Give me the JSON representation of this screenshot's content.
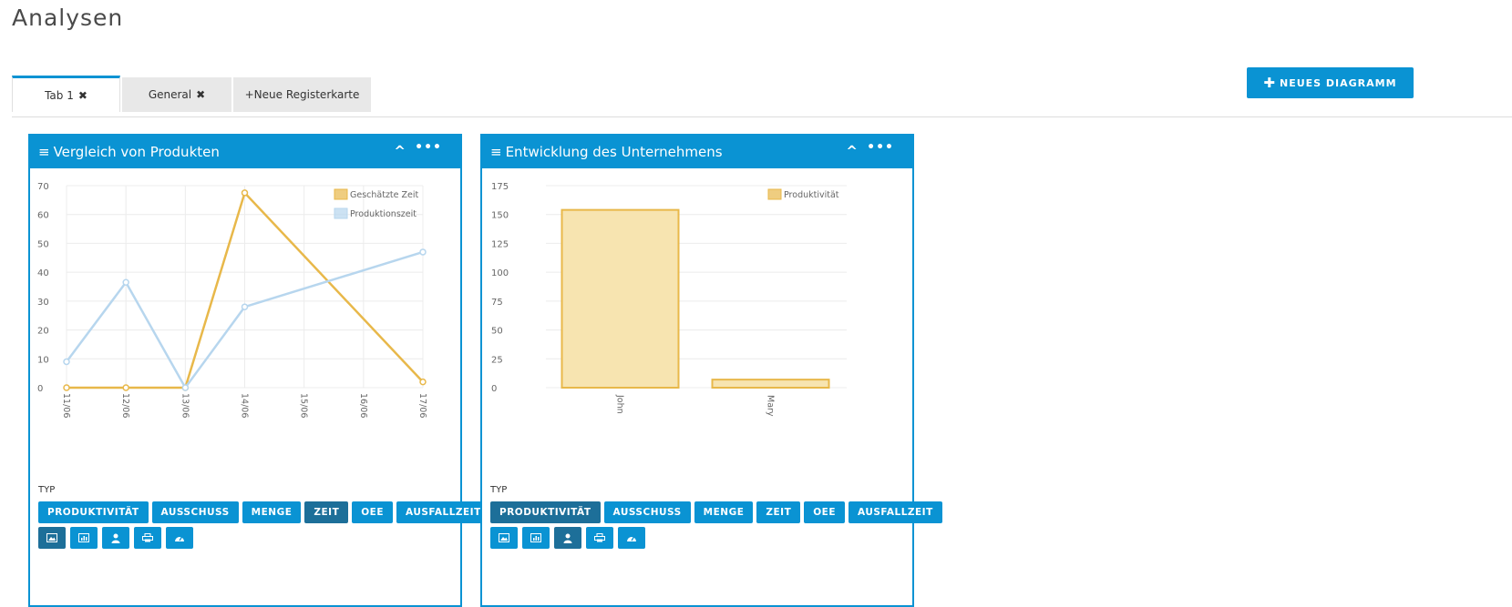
{
  "page": {
    "title": "Analysen"
  },
  "tabs": [
    {
      "label": "Tab 1",
      "closable": true,
      "active": true
    },
    {
      "label": "General",
      "closable": true,
      "active": false
    },
    {
      "label": "+Neue Registerkarte",
      "closable": false,
      "active": false
    }
  ],
  "toolbar": {
    "new_chart_label": "NEUES DIAGRAMM",
    "new_chart_icon": "plus-icon"
  },
  "colors": {
    "accent": "#0a93d3",
    "accent_selected": "#1d6f99",
    "series_gold": "#e8b84a",
    "series_blue": "#b7d6ee"
  },
  "panels": [
    {
      "title": "Vergleich von Produkten",
      "type_label": "TYP",
      "type_buttons": [
        "PRODUKTIVITÄT",
        "AUSSCHUSS",
        "MENGE",
        "ZEIT",
        "OEE",
        "AUSFALLZEIT"
      ],
      "selected_type": "ZEIT",
      "icon_buttons": [
        "image-icon",
        "bar-chart-icon",
        "user-icon",
        "printer-icon",
        "gauge-icon"
      ],
      "selected_icon": "image-icon"
    },
    {
      "title": "Entwicklung des Unternehmens",
      "type_label": "TYP",
      "type_buttons": [
        "PRODUKTIVITÄT",
        "AUSSCHUSS",
        "MENGE",
        "ZEIT",
        "OEE",
        "AUSFALLZEIT"
      ],
      "selected_type": "PRODUKTIVITÄT",
      "icon_buttons": [
        "image-icon",
        "bar-chart-icon",
        "user-icon",
        "printer-icon",
        "gauge-icon"
      ],
      "selected_icon": "user-icon"
    }
  ],
  "chart_data": [
    {
      "type": "line",
      "x": [
        "11/06",
        "12/06",
        "13/06",
        "14/06",
        "15/06",
        "16/06",
        "17/06"
      ],
      "series": [
        {
          "name": "Geschätzte Zeit",
          "color": "#e8b84a",
          "values": [
            0,
            0,
            0,
            67.5,
            null,
            null,
            2
          ]
        },
        {
          "name": "Produktionszeit",
          "color": "#b7d6ee",
          "values": [
            9,
            36.5,
            0,
            28,
            null,
            null,
            47
          ]
        }
      ],
      "ylim": [
        0,
        70
      ],
      "yticks": [
        0,
        10,
        20,
        30,
        40,
        50,
        60,
        70
      ],
      "grid": true,
      "legend": "top-right"
    },
    {
      "type": "bar",
      "categories": [
        "John",
        "Mary"
      ],
      "series": [
        {
          "name": "Produktivität",
          "color": "#e8b84a",
          "values": [
            154,
            7
          ]
        }
      ],
      "ylim": [
        0,
        175
      ],
      "yticks": [
        0,
        25,
        50,
        75,
        100,
        125,
        150,
        175
      ],
      "grid": true,
      "legend": "top-right"
    }
  ]
}
